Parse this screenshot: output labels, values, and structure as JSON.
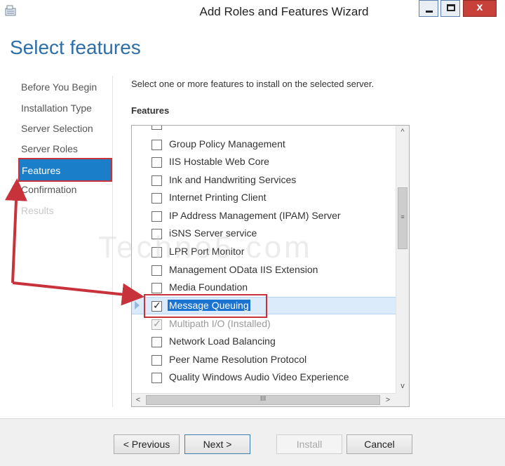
{
  "window": {
    "title": "Add Roles and Features Wizard",
    "close_glyph": "x"
  },
  "page_title": "Select features",
  "nav": {
    "items": [
      {
        "label": "Before You Begin",
        "state": "normal"
      },
      {
        "label": "Installation Type",
        "state": "normal"
      },
      {
        "label": "Server Selection",
        "state": "normal"
      },
      {
        "label": "Server Roles",
        "state": "normal"
      },
      {
        "label": "Features",
        "state": "selected"
      },
      {
        "label": "Confirmation",
        "state": "normal"
      },
      {
        "label": "Results",
        "state": "disabled"
      }
    ]
  },
  "content": {
    "instruction": "Select one or more features to install on the selected server.",
    "features_label": "Features"
  },
  "features": [
    {
      "label": "Group Policy Management",
      "checked": false
    },
    {
      "label": "IIS Hostable Web Core",
      "checked": false
    },
    {
      "label": "Ink and Handwriting Services",
      "checked": false
    },
    {
      "label": "Internet Printing Client",
      "checked": false
    },
    {
      "label": "IP Address Management (IPAM) Server",
      "checked": false
    },
    {
      "label": "iSNS Server service",
      "checked": false
    },
    {
      "label": "LPR Port Monitor",
      "checked": false
    },
    {
      "label": "Management OData IIS Extension",
      "checked": false
    },
    {
      "label": "Media Foundation",
      "checked": false
    },
    {
      "label": "Message Queuing",
      "checked": true,
      "selected": true,
      "expandable": true
    },
    {
      "label": "Multipath I/O (Installed)",
      "checked": true,
      "disabled": true
    },
    {
      "label": "Network Load Balancing",
      "checked": false
    },
    {
      "label": "Peer Name Resolution Protocol",
      "checked": false
    },
    {
      "label": "Quality Windows Audio Video Experience",
      "checked": false
    }
  ],
  "scrollbar": {
    "up": "^",
    "down": "v",
    "left": "<",
    "right": ">",
    "v_grip": "≡",
    "h_grip": "III"
  },
  "footer": {
    "previous": "< Previous",
    "next": "Next >",
    "install": "Install",
    "cancel": "Cancel"
  },
  "watermark": "Techno5.com",
  "colors": {
    "accent": "#1a7ec9",
    "title_blue": "#2e6fa8",
    "annotation_red": "#c8323a",
    "close_red": "#c7403a"
  }
}
